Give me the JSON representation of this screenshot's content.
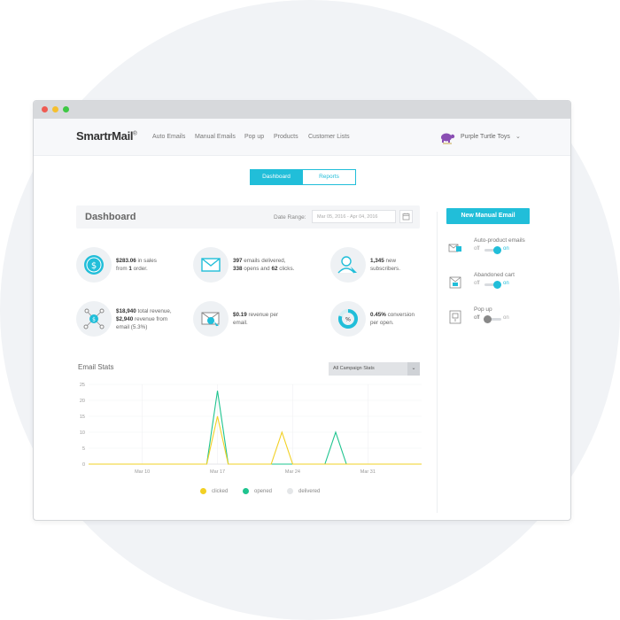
{
  "nav": {
    "logo_main": "Smartr",
    "logo_r": "",
    "logo_mail": "Mail",
    "logo_mark": "®",
    "links": [
      "Auto Emails",
      "Manual Emails",
      "Pop up",
      "Products",
      "Customer Lists"
    ],
    "store_name": "Purple Turtle Toys",
    "store_caret": "⌄"
  },
  "tabs": {
    "dashboard": "Dashboard",
    "reports": "Reports"
  },
  "dashboard": {
    "title": "Dashboard",
    "date_range_label": "Date Range:",
    "date_range_value": "Mar 05, 2016 - Apr 04, 2016"
  },
  "stats": {
    "sales": {
      "v1": "$283.06",
      "t1": " in sales",
      "t2": "from ",
      "v2": "1",
      "t3": " order."
    },
    "emails": {
      "v1": "397",
      "t1": " emails delivered,",
      "v2": "338",
      "t2": " opens and ",
      "v3": "62",
      "t3": " clicks."
    },
    "subs": {
      "v1": "1,345",
      "t1": " new",
      "t2": "subscribers."
    },
    "revenue": {
      "v1": "$18,940",
      "t1": " total revenue,",
      "v2": "$2,940",
      "t2": " revenue from",
      "t3": "email (5.3%)"
    },
    "per_email": {
      "v1": "$0.19",
      "t1": " revenue per",
      "t2": "email."
    },
    "conversion": {
      "v1": "0.45%",
      "t1": " conversion",
      "t2": "per open."
    }
  },
  "email_stats": {
    "title": "Email Stats",
    "dropdown_value": "All Campaign Stats",
    "dropdown_arrow": "⌄"
  },
  "chart_data": {
    "type": "line",
    "x": [
      0,
      1,
      2,
      3,
      4,
      5,
      6,
      7,
      8,
      9,
      10,
      11,
      12,
      13,
      14,
      15,
      16,
      17,
      18,
      19,
      20,
      21,
      22,
      23,
      24,
      25,
      26,
      27,
      28,
      29,
      30,
      31
    ],
    "x_tick_labels": [
      "Mar 10",
      "Mar 17",
      "Mar 24",
      "Mar 31"
    ],
    "x_tick_positions": [
      5,
      12,
      19,
      26
    ],
    "ylim": [
      0,
      25
    ],
    "y_ticks": [
      0,
      5,
      10,
      15,
      20,
      25
    ],
    "grid": true,
    "legend_position": "bottom",
    "series": [
      {
        "name": "clicked",
        "color": "#f2d024",
        "values": [
          0,
          0,
          0,
          0,
          0,
          0,
          0,
          0,
          0,
          0,
          0,
          0,
          15,
          0,
          0,
          0,
          0,
          0,
          10,
          0,
          0,
          0,
          0,
          0,
          0,
          0,
          0,
          0,
          0,
          0,
          0,
          0
        ]
      },
      {
        "name": "opened",
        "color": "#1fc48f",
        "values": [
          0,
          0,
          0,
          0,
          0,
          0,
          0,
          0,
          0,
          0,
          0,
          0,
          23,
          0,
          0,
          0,
          0,
          0,
          0,
          0,
          0,
          0,
          0,
          10,
          0,
          0,
          0,
          0,
          0,
          0,
          0,
          0
        ]
      },
      {
        "name": "delivered",
        "color": "#e4e6e8",
        "values": [
          0,
          0,
          0,
          0,
          0,
          0,
          0,
          0,
          0,
          0,
          0,
          0,
          0,
          0,
          0,
          0,
          0,
          0,
          0,
          0,
          0,
          0,
          0,
          0,
          0,
          0,
          0,
          0,
          0,
          0,
          0,
          0
        ]
      }
    ]
  },
  "sidebar": {
    "new_email_button": "New Manual Email",
    "items": [
      {
        "label": "Auto-product emails",
        "off": "off",
        "on": "on",
        "state": "on"
      },
      {
        "label": "Abandoned cart",
        "off": "off",
        "on": "on",
        "state": "on"
      },
      {
        "label": "Pop up",
        "off": "off",
        "on": "on",
        "state": "off"
      }
    ]
  },
  "colors": {
    "accent": "#21bed9",
    "clicked": "#f2d024",
    "opened": "#1fc48f",
    "delivered": "#e4e6e8",
    "dot_red": "#ef5b52",
    "dot_yellow": "#f5bf2f",
    "dot_green": "#3ec844"
  },
  "icons": {
    "sales": "dollar-coin-icon",
    "emails": "envelope-icon",
    "subs": "user-add-icon",
    "revenue": "network-dollar-icon",
    "per_email": "email-cursor-icon",
    "conversion": "percent-donut-icon",
    "calendar": "calendar-icon"
  }
}
